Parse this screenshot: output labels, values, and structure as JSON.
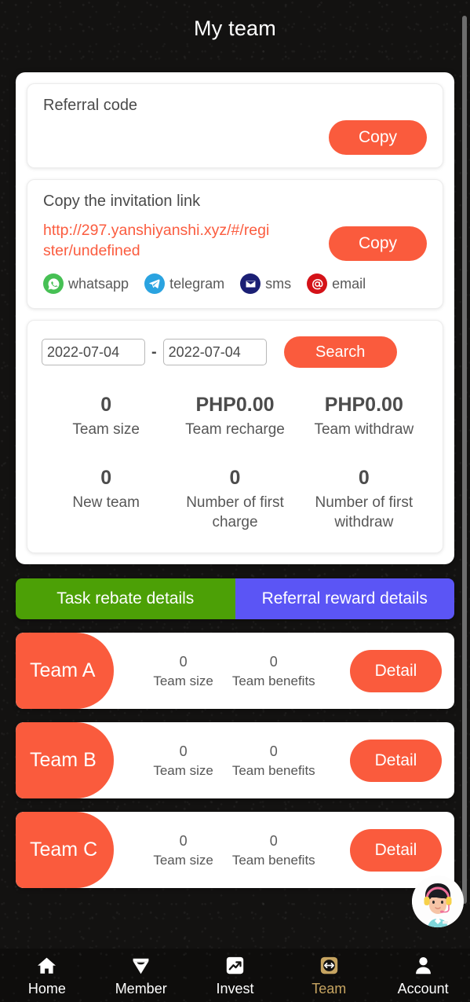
{
  "header": {
    "title": "My team"
  },
  "referral": {
    "label": "Referral code",
    "code": "",
    "copy_label": "Copy"
  },
  "invitation": {
    "label": "Copy the invitation link",
    "link": "http://297.yanshiyanshi.xyz/#/register/undefined",
    "copy_label": "Copy",
    "share": [
      {
        "name": "whatsapp",
        "label": "whatsapp",
        "icon": "whatsapp-icon",
        "color": "#46c054"
      },
      {
        "name": "telegram",
        "label": "telegram",
        "icon": "telegram-icon",
        "color": "#2aa3e0"
      },
      {
        "name": "sms",
        "label": "sms",
        "icon": "sms-icon",
        "color": "#1b1f74"
      },
      {
        "name": "email",
        "label": "email",
        "icon": "email-icon",
        "color": "#d41218"
      }
    ]
  },
  "search": {
    "start_date": "2022-07-04",
    "end_date": "2022-07-04",
    "separator": "-",
    "button_label": "Search"
  },
  "stats_row1": [
    {
      "value": "0",
      "label": "Team size"
    },
    {
      "value": "PHP0.00",
      "label": "Team recharge"
    },
    {
      "value": "PHP0.00",
      "label": "Team withdraw"
    }
  ],
  "stats_row2": [
    {
      "value": "0",
      "label": "New team"
    },
    {
      "value": "0",
      "label": "Number of first charge"
    },
    {
      "value": "0",
      "label": "Number of first withdraw"
    }
  ],
  "tabs": {
    "rebate_label": "Task rebate details",
    "rebate_color": "#4ca006",
    "referral_label": "Referral reward details",
    "referral_color": "#5b55f5"
  },
  "teams": [
    {
      "name": "Team A",
      "size_value": "0",
      "size_label": "Team size",
      "benefits_value": "0",
      "benefits_label": "Team benefits",
      "detail_label": "Detail"
    },
    {
      "name": "Team B",
      "size_value": "0",
      "size_label": "Team size",
      "benefits_value": "0",
      "benefits_label": "Team benefits",
      "detail_label": "Detail"
    },
    {
      "name": "Team C",
      "size_value": "0",
      "size_label": "Team size",
      "benefits_value": "0",
      "benefits_label": "Team benefits",
      "detail_label": "Detail"
    }
  ],
  "support": {
    "icon": "customer-service-avatar-icon"
  },
  "bottom_nav": {
    "active": "Team",
    "active_color": "#c6a461",
    "items": [
      {
        "label": "Home",
        "icon": "home-icon"
      },
      {
        "label": "Member",
        "icon": "diamond-icon"
      },
      {
        "label": "Invest",
        "icon": "chart-up-icon"
      },
      {
        "label": "Team",
        "icon": "team-exchange-icon"
      },
      {
        "label": "Account",
        "icon": "person-icon"
      }
    ]
  },
  "theme": {
    "accent_red": "#fa5b3d",
    "link_red": "#fb5c3f"
  }
}
